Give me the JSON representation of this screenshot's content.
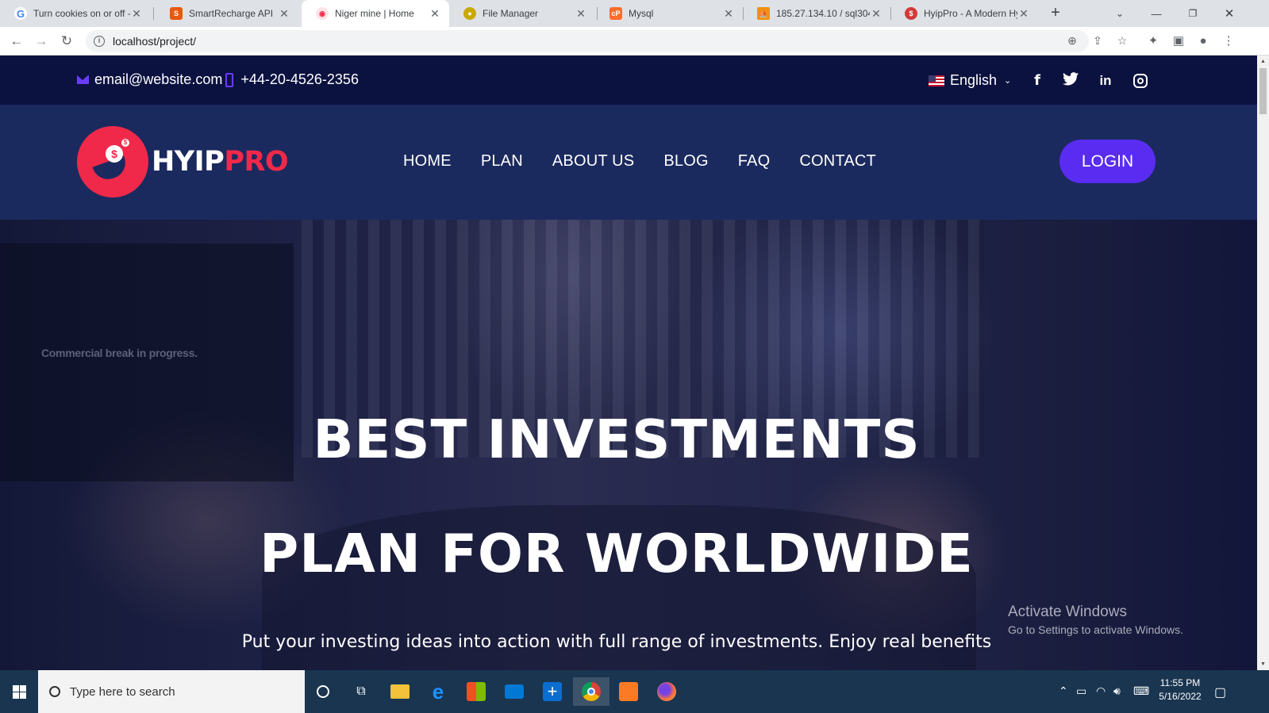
{
  "browser": {
    "tabs": [
      {
        "title": "Turn cookies on or off -",
        "favicon": "google-icon",
        "favicon_color": "#4285f4",
        "active": false
      },
      {
        "title": "SmartRecharge API",
        "favicon": "api-icon",
        "favicon_color": "#e8590c",
        "active": false
      },
      {
        "title": "Niger mine | Home",
        "favicon": "site-icon",
        "favicon_color": "#f0294a",
        "active": true
      },
      {
        "title": "File Manager",
        "favicon": "file-manager-icon",
        "favicon_color": "#c9a900",
        "active": false
      },
      {
        "title": "Mysql",
        "favicon": "cpanel-icon",
        "favicon_color": "#ff6c2c",
        "active": false
      },
      {
        "title": "185.27.134.10 / sql304.",
        "favicon": "phpmyadmin-icon",
        "favicon_color": "#f29111",
        "active": false
      },
      {
        "title": "HyipPro - A Modern Hy",
        "favicon": "hyippro-icon",
        "favicon_color": "#d23a3a",
        "active": false
      }
    ],
    "new_tab": "+",
    "url": "localhost/project/"
  },
  "site": {
    "topbar": {
      "email": "email@website.com",
      "phone": "+44-20-4526-2356",
      "language": "English",
      "socials": [
        "facebook-icon",
        "twitter-icon",
        "linkedin-icon",
        "instagram-icon"
      ]
    },
    "logo": {
      "text_white": "HYIP",
      "text_red": "PRO"
    },
    "menu": [
      "HOME",
      "PLAN",
      "ABOUT US",
      "BLOG",
      "FAQ",
      "CONTACT"
    ],
    "login_label": "LOGIN",
    "hero": {
      "background_text": "Commercial break in progress.",
      "title_line1": "BEST INVESTMENTS",
      "title_line2": "PLAN FOR WORLDWIDE",
      "subtitle": "Put your investing ideas into action with full range of investments. Enjoy real benefits"
    },
    "colors": {
      "navy_topbar": "#0c1240",
      "navy_nav": "#1b2a5e",
      "accent_purple": "#5a2cf2",
      "brand_red": "#f0294a"
    }
  },
  "windows_watermark": {
    "title": "Activate Windows",
    "subtitle": "Go to Settings to activate Windows."
  },
  "taskbar": {
    "search_placeholder": "Type here to search",
    "time": "11:55 PM",
    "date": "5/16/2022"
  }
}
